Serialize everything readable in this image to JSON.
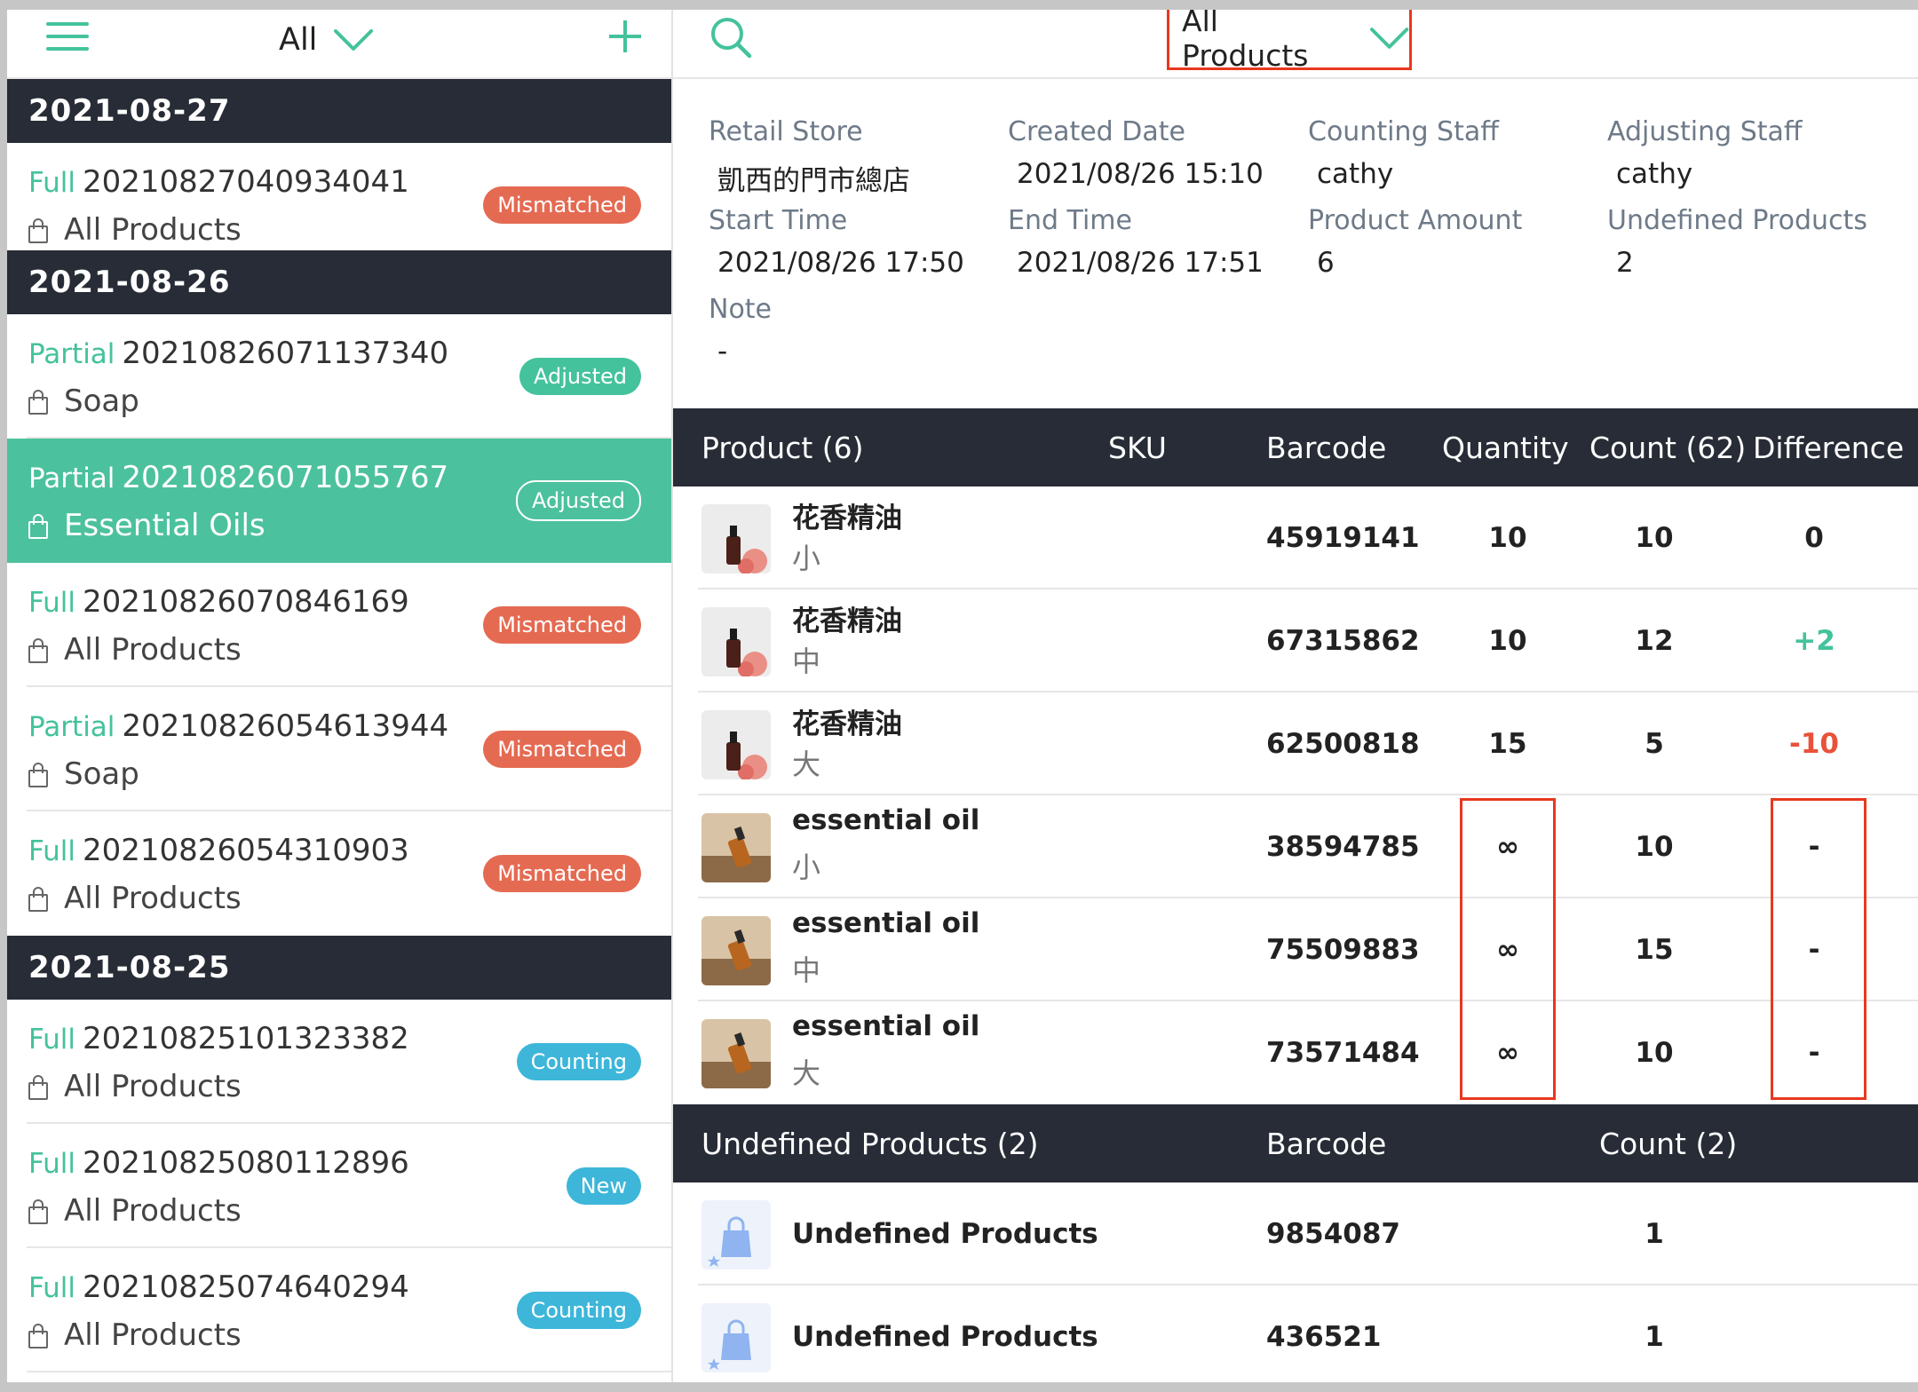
{
  "left_panel": {
    "filter_label": "All",
    "groups": [
      {
        "date": "2021-08-27",
        "items": [
          {
            "type": "Full",
            "id": "20210827040934041",
            "scope": "All Products",
            "status": "Mismatched",
            "status_color": "#e56a52"
          }
        ]
      },
      {
        "date": "2021-08-26",
        "items": [
          {
            "type": "Partial",
            "id": "20210826071137340",
            "scope": "Soap",
            "status": "Adjusted",
            "status_color": "#44c29c"
          },
          {
            "type": "Partial",
            "id": "20210826071055767",
            "scope": "Essential Oils",
            "status": "Adjusted",
            "status_color": "#44c29c"
          },
          {
            "type": "Full",
            "id": "20210826070846169",
            "scope": "All Products",
            "status": "Mismatched",
            "status_color": "#e56a52"
          },
          {
            "type": "Partial",
            "id": "20210826054613944",
            "scope": "Soap",
            "status": "Mismatched",
            "status_color": "#e56a52"
          },
          {
            "type": "Full",
            "id": "20210826054310903",
            "scope": "All Products",
            "status": "Mismatched",
            "status_color": "#e56a52"
          }
        ]
      },
      {
        "date": "2021-08-25",
        "items": [
          {
            "type": "Full",
            "id": "20210825101323382",
            "scope": "All Products",
            "status": "Counting",
            "status_color": "#3db6d9"
          },
          {
            "type": "Full",
            "id": "20210825080112896",
            "scope": "All Products",
            "status": "New",
            "status_color": "#3db6d9"
          },
          {
            "type": "Full",
            "id": "20210825074640294",
            "scope": "All Products",
            "status": "Counting",
            "status_color": "#3db6d9"
          }
        ]
      }
    ]
  },
  "right_panel": {
    "filter_label": "All Products",
    "info": {
      "retail_store": {
        "label": "Retail Store",
        "value": "凱西的門市總店"
      },
      "created_date": {
        "label": "Created Date",
        "value": "2021/08/26 15:10"
      },
      "counting_staff": {
        "label": "Counting Staff",
        "value": "cathy"
      },
      "adjusting_staff": {
        "label": "Adjusting Staff",
        "value": "cathy"
      },
      "start_time": {
        "label": "Start Time",
        "value": "2021/08/26 17:50"
      },
      "end_time": {
        "label": "End Time",
        "value": "2021/08/26 17:51"
      },
      "product_amount": {
        "label": "Product Amount",
        "value": "6"
      },
      "undefined_products": {
        "label": "Undefined Products",
        "value": "2"
      },
      "note": {
        "label": "Note",
        "value": "-"
      }
    },
    "products_table": {
      "headers": {
        "product": "Product (6)",
        "sku": "SKU",
        "barcode": "Barcode",
        "quantity": "Quantity",
        "count": "Count (62)",
        "difference": "Difference"
      },
      "rows": [
        {
          "name": "花香精油",
          "variant": "小",
          "barcode": "45919141",
          "quantity": "10",
          "count": "10",
          "difference": "0",
          "diff_color": "#222222",
          "thumb": "rose-oil"
        },
        {
          "name": "花香精油",
          "variant": "中",
          "barcode": "67315862",
          "quantity": "10",
          "count": "12",
          "difference": "+2",
          "diff_color": "#44c29c",
          "thumb": "rose-oil"
        },
        {
          "name": "花香精油",
          "variant": "大",
          "barcode": "62500818",
          "quantity": "15",
          "count": "5",
          "difference": "-10",
          "diff_color": "#e8523a",
          "thumb": "rose-oil"
        },
        {
          "name": "essential oil",
          "variant": "小",
          "barcode": "38594785",
          "quantity": "∞",
          "count": "10",
          "difference": "-",
          "diff_color": "#222222",
          "thumb": "amber-oil"
        },
        {
          "name": "essential oil",
          "variant": "中",
          "barcode": "75509883",
          "quantity": "∞",
          "count": "15",
          "difference": "-",
          "diff_color": "#222222",
          "thumb": "amber-oil"
        },
        {
          "name": "essential oil",
          "variant": "大",
          "barcode": "73571484",
          "quantity": "∞",
          "count": "10",
          "difference": "-",
          "diff_color": "#222222",
          "thumb": "amber-oil"
        }
      ]
    },
    "undefined_table": {
      "headers": {
        "product": "Undefined Products (2)",
        "barcode": "Barcode",
        "count": "Count (2)"
      },
      "rows": [
        {
          "name": "Undefined Products",
          "barcode": "9854087",
          "count": "1",
          "thumb": "shopping-bag-icon"
        },
        {
          "name": "Undefined Products",
          "barcode": "436521",
          "count": "1",
          "thumb": "shopping-bag-icon"
        }
      ]
    }
  },
  "colors": {
    "accent": "#44c29c",
    "header_bg": "#272c36",
    "highlight": "#e8381e"
  }
}
